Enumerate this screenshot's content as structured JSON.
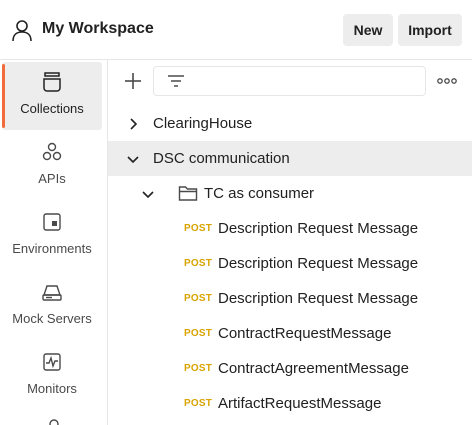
{
  "header": {
    "workspace_title": "My Workspace",
    "new_label": "New",
    "import_label": "Import"
  },
  "sidebar": {
    "items": [
      {
        "label": "Collections",
        "icon": "collections-icon",
        "active": true
      },
      {
        "label": "APIs",
        "icon": "apis-icon",
        "active": false
      },
      {
        "label": "Environments",
        "icon": "environments-icon",
        "active": false
      },
      {
        "label": "Mock Servers",
        "icon": "mock-servers-icon",
        "active": false
      },
      {
        "label": "Monitors",
        "icon": "monitors-icon",
        "active": false
      }
    ]
  },
  "toolbar": {
    "add_icon": "plus-icon",
    "filter_icon": "filter-icon",
    "more_icon": "more-horizontal-icon"
  },
  "tree": {
    "collections": [
      {
        "name": "ClearingHouse",
        "expanded": false
      },
      {
        "name": "DSC communication",
        "expanded": true
      }
    ],
    "folder": {
      "name": "TC as consumer",
      "expanded": true
    },
    "requests": [
      {
        "method": "POST",
        "name": "Description Request Message"
      },
      {
        "method": "POST",
        "name": "Description Request Message"
      },
      {
        "method": "POST",
        "name": "Description Request Message"
      },
      {
        "method": "POST",
        "name": "ContractRequestMessage"
      },
      {
        "method": "POST",
        "name": "ContractAgreementMessage"
      },
      {
        "method": "POST",
        "name": "ArtifactRequestMessage"
      }
    ]
  },
  "colors": {
    "accent": "#f26b3a",
    "post_method": "#d9a400",
    "selected_row": "#ededed"
  }
}
